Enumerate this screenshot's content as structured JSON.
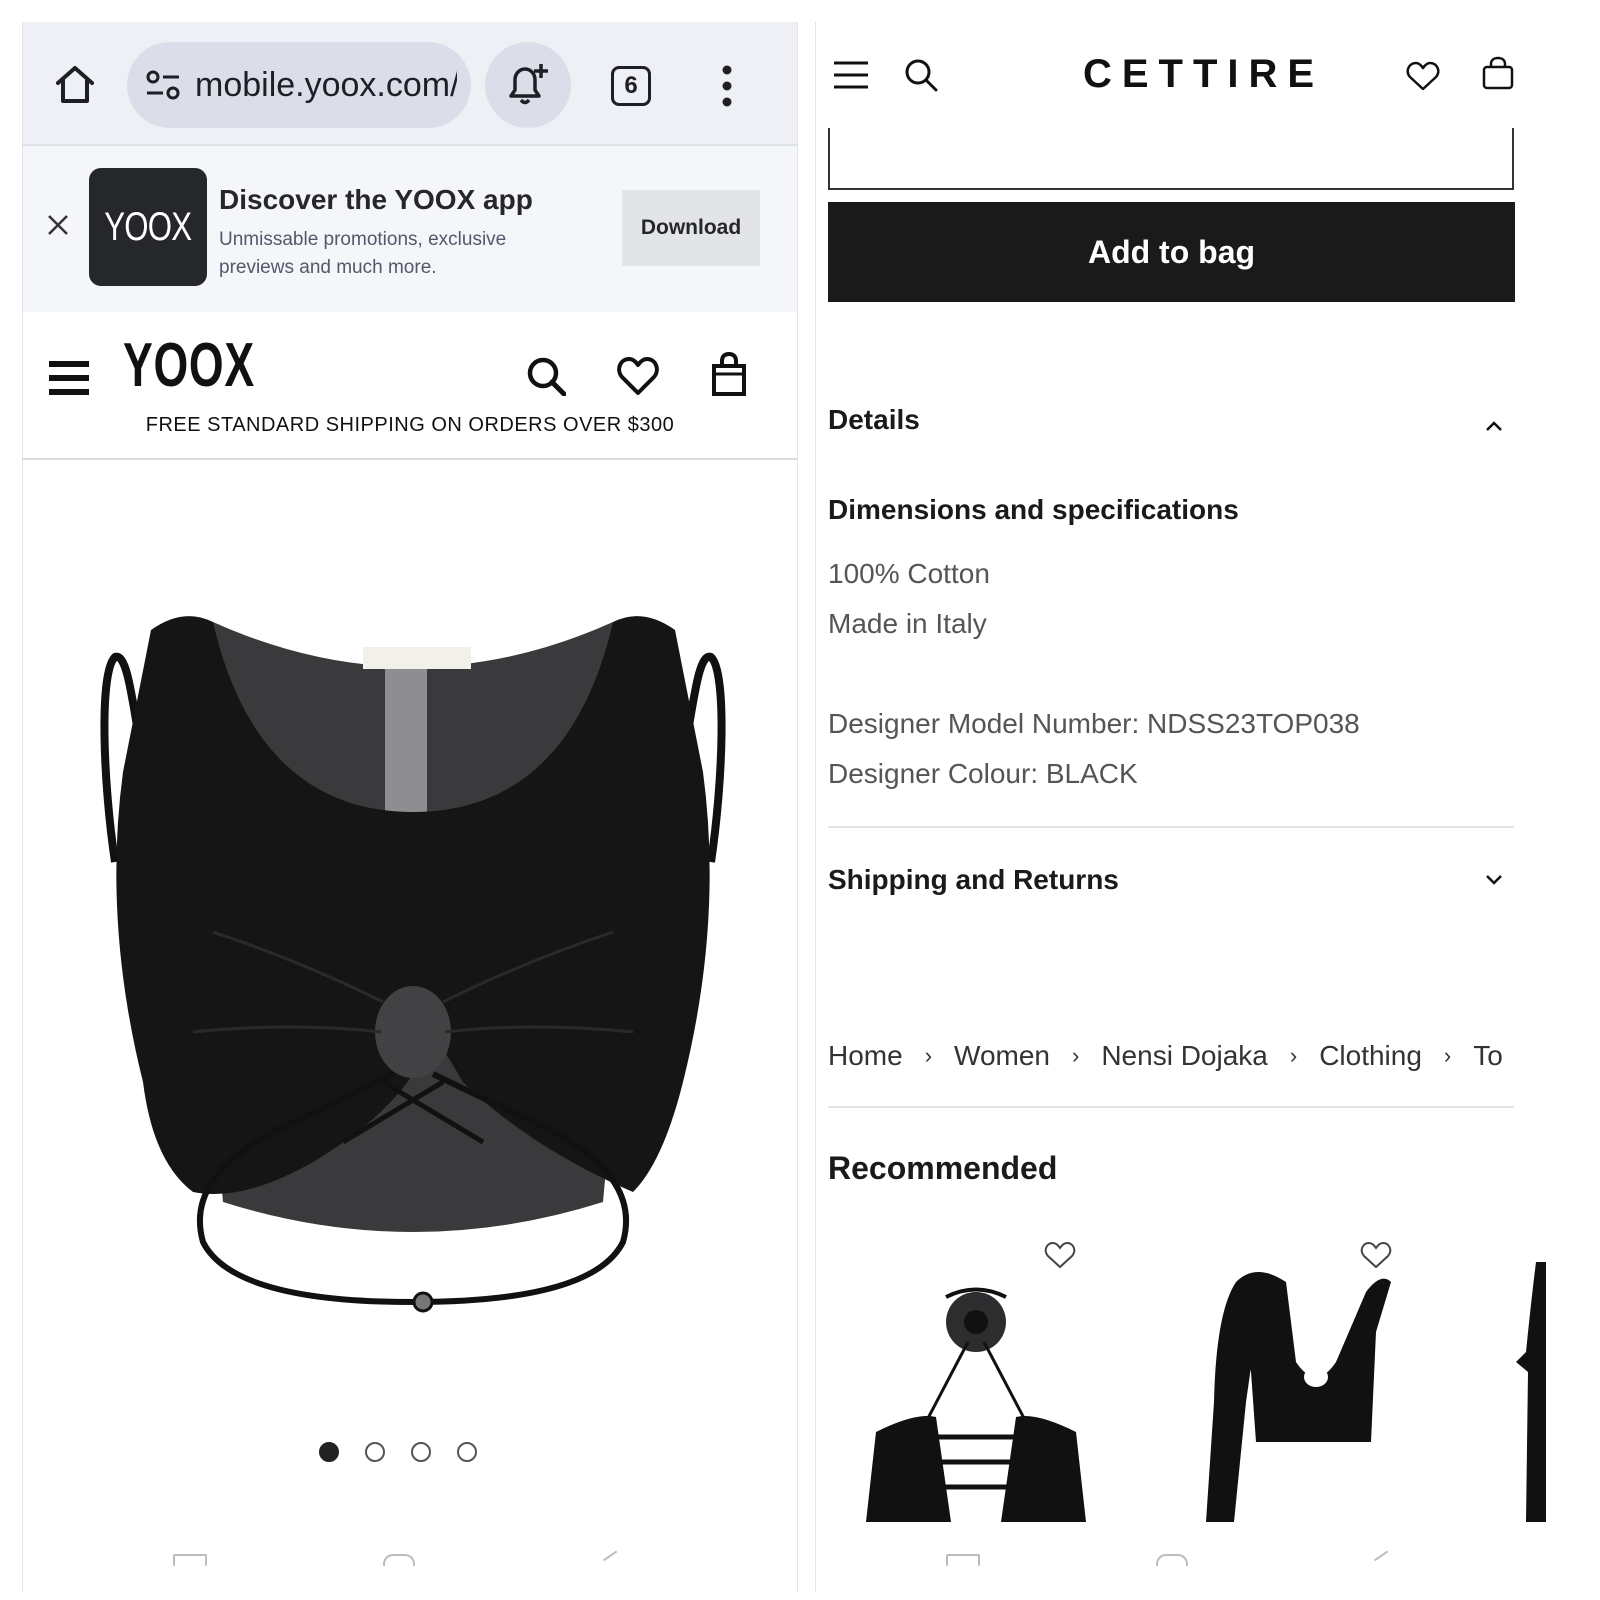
{
  "left": {
    "browser": {
      "url": "mobile.yoox.com/",
      "tab_count": "6"
    },
    "app_banner": {
      "logo": "YOOX",
      "title": "Discover the YOOX app",
      "subtitle": "Unmissable promotions, exclusive previews and much more.",
      "download_label": "Download"
    },
    "site": {
      "logo": "YOOX",
      "promo": "FREE STANDARD SHIPPING ON ORDERS OVER $300"
    },
    "gallery": {
      "total_images": 4,
      "active_index": 0
    }
  },
  "right": {
    "logo": "CETTIRE",
    "size_value_partial": "",
    "add_to_bag_label": "Add to bag",
    "details": {
      "heading": "Details",
      "expanded": true,
      "spec_heading": "Dimensions and specifications",
      "material": "100% Cotton",
      "origin": "Made in Italy",
      "model_number": "Designer Model Number: NDSS23TOP038",
      "colour": "Designer Colour: BLACK"
    },
    "shipping": {
      "heading": "Shipping and Returns",
      "expanded": false
    },
    "breadcrumb": {
      "items": [
        "Home",
        "Women",
        "Nensi Dojaka",
        "Clothing",
        "To"
      ],
      "separator": "›"
    },
    "recommended": {
      "heading": "Recommended"
    }
  },
  "colors": {
    "browser_bar": "#eef0f6",
    "url_pill": "#dbdee8",
    "yoox_dark": "#26272b",
    "button_dark": "#1a1a1a"
  }
}
